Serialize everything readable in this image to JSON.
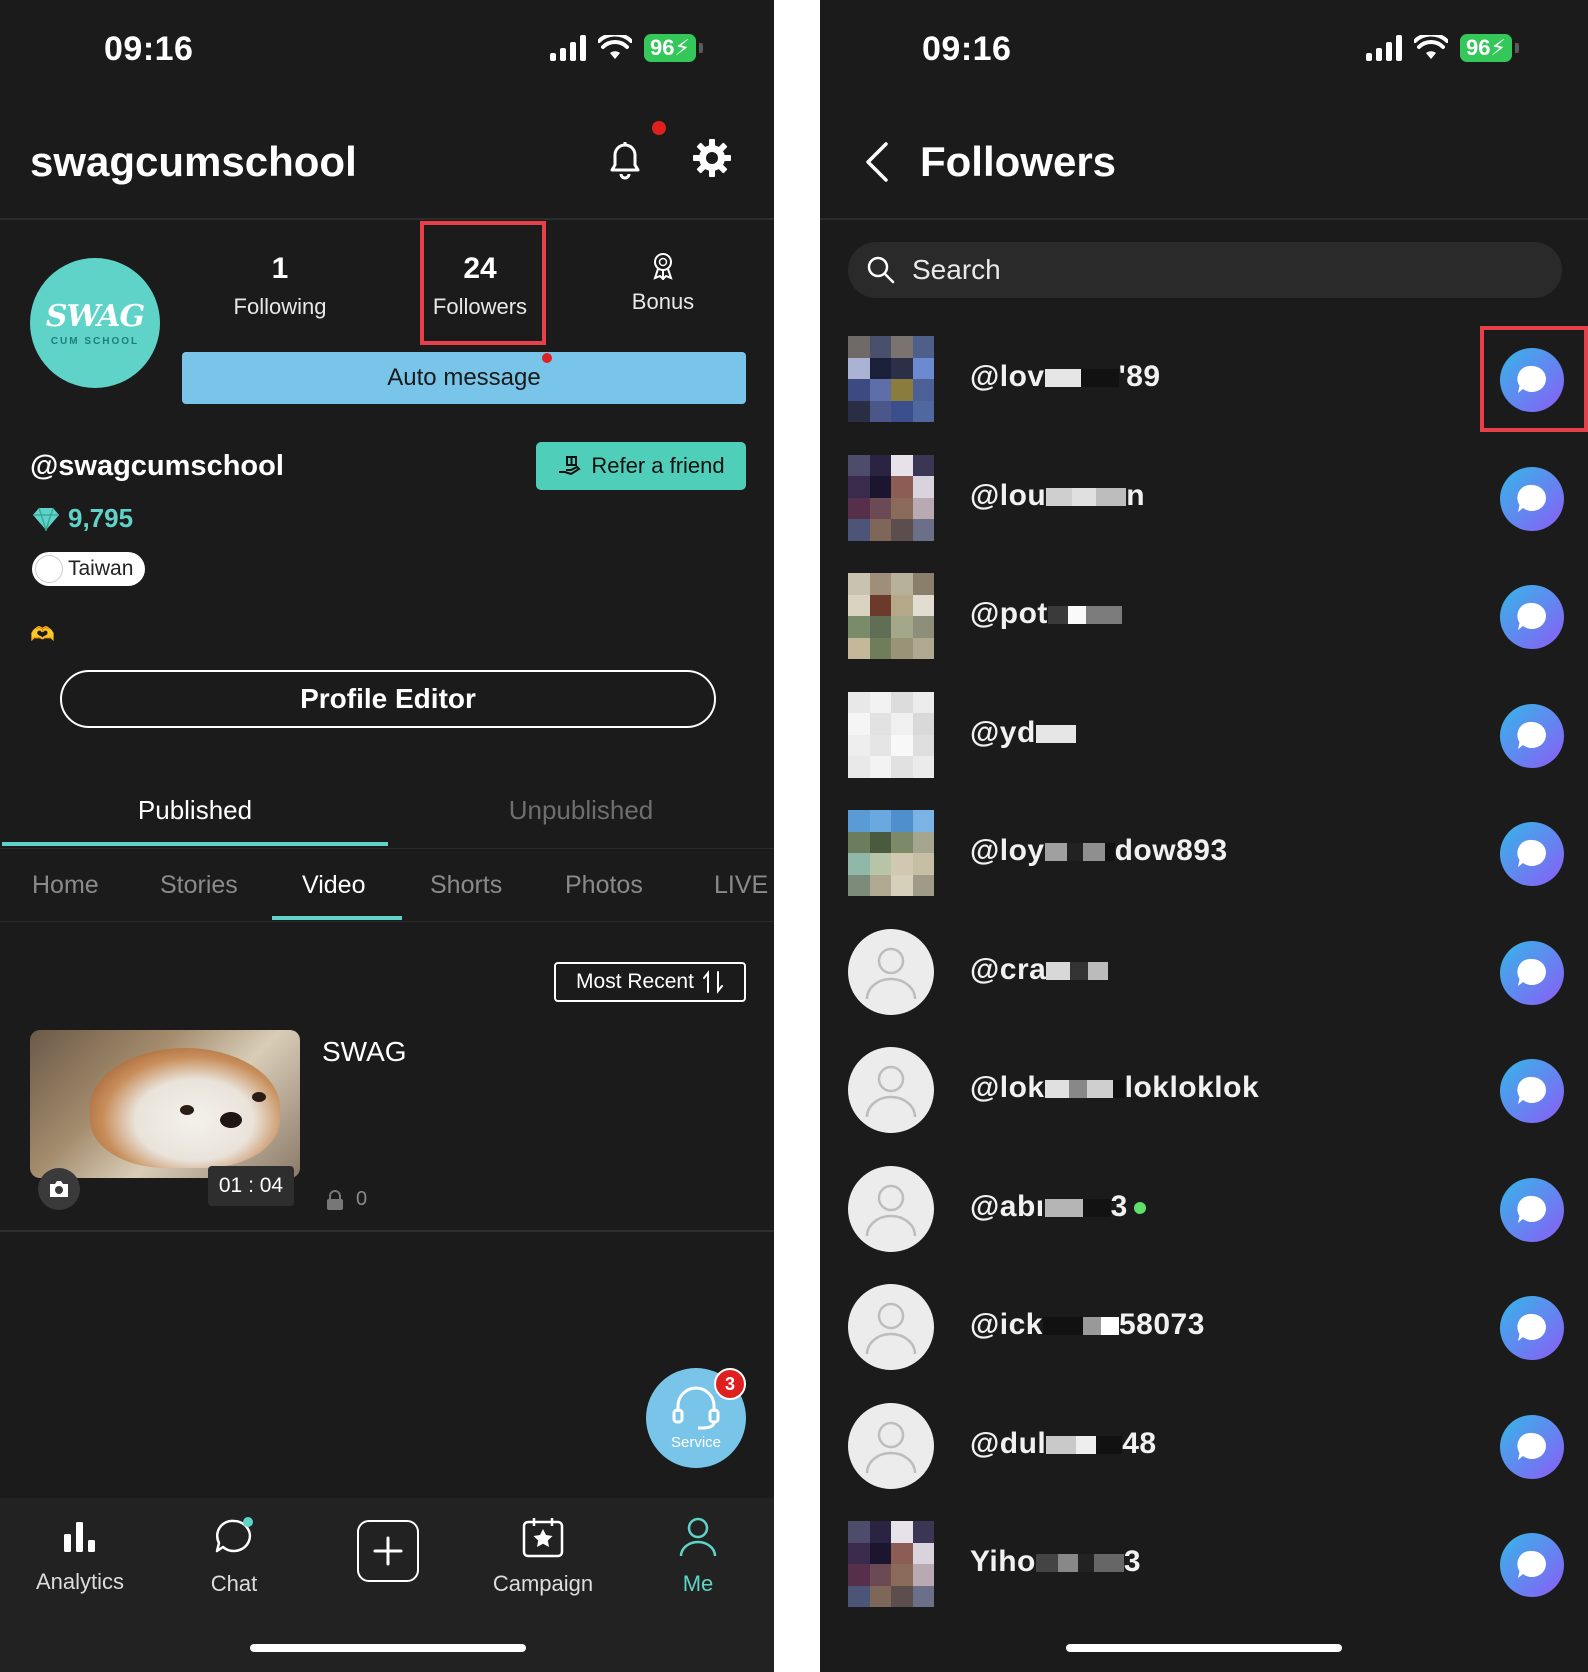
{
  "left": {
    "status": {
      "time": "09:16",
      "battery": "96"
    },
    "header": {
      "username_title": "swagcumschool"
    },
    "logo": {
      "main": "SWAG",
      "sub": "CUM SCHOOL"
    },
    "stats": {
      "following_count": "1",
      "following_label": "Following",
      "followers_count": "24",
      "followers_label": "Followers",
      "bonus_label": "Bonus"
    },
    "auto_message_label": "Auto message",
    "handle": "@swagcumschool",
    "refer_label": "Refer a friend",
    "gems": "9,795",
    "region": "Taiwan",
    "profile_editor_label": "Profile Editor",
    "publish_tabs": {
      "published": "Published",
      "unpublished": "Unpublished"
    },
    "content_tabs": {
      "home": "Home",
      "stories": "Stories",
      "video": "Video",
      "shorts": "Shorts",
      "photos": "Photos",
      "live": "LIVE"
    },
    "sort_label": "Most Recent",
    "video": {
      "title": "SWAG",
      "duration": "01 : 04",
      "locked_count": "0"
    },
    "service": {
      "label": "Service",
      "badge": "3"
    },
    "nav": {
      "analytics": "Analytics",
      "chat": "Chat",
      "campaign": "Campaign",
      "me": "Me"
    },
    "colors": {
      "accent": "#5fd3c7",
      "auto_message": "#79c5ea",
      "highlight": "#e8404a"
    }
  },
  "right": {
    "status": {
      "time": "09:16",
      "battery": "96"
    },
    "title": "Followers",
    "search_placeholder": "Search",
    "followers": [
      {
        "pre": "@lov",
        "post": "'89"
      },
      {
        "pre": "@lou",
        "post": "n"
      },
      {
        "pre": "@pot",
        "post": ""
      },
      {
        "pre": "@yd",
        "post": ""
      },
      {
        "pre": "@loy",
        "post": "dow893"
      },
      {
        "pre": "@cra",
        "post": ""
      },
      {
        "pre": "@lok",
        "post": "lokloklok"
      },
      {
        "pre": "@abı",
        "post": "3"
      },
      {
        "pre": "@ick",
        "post": "58073"
      },
      {
        "pre": "@dul",
        "post": "48"
      },
      {
        "pre": "Yiho",
        "post": "3"
      }
    ]
  }
}
